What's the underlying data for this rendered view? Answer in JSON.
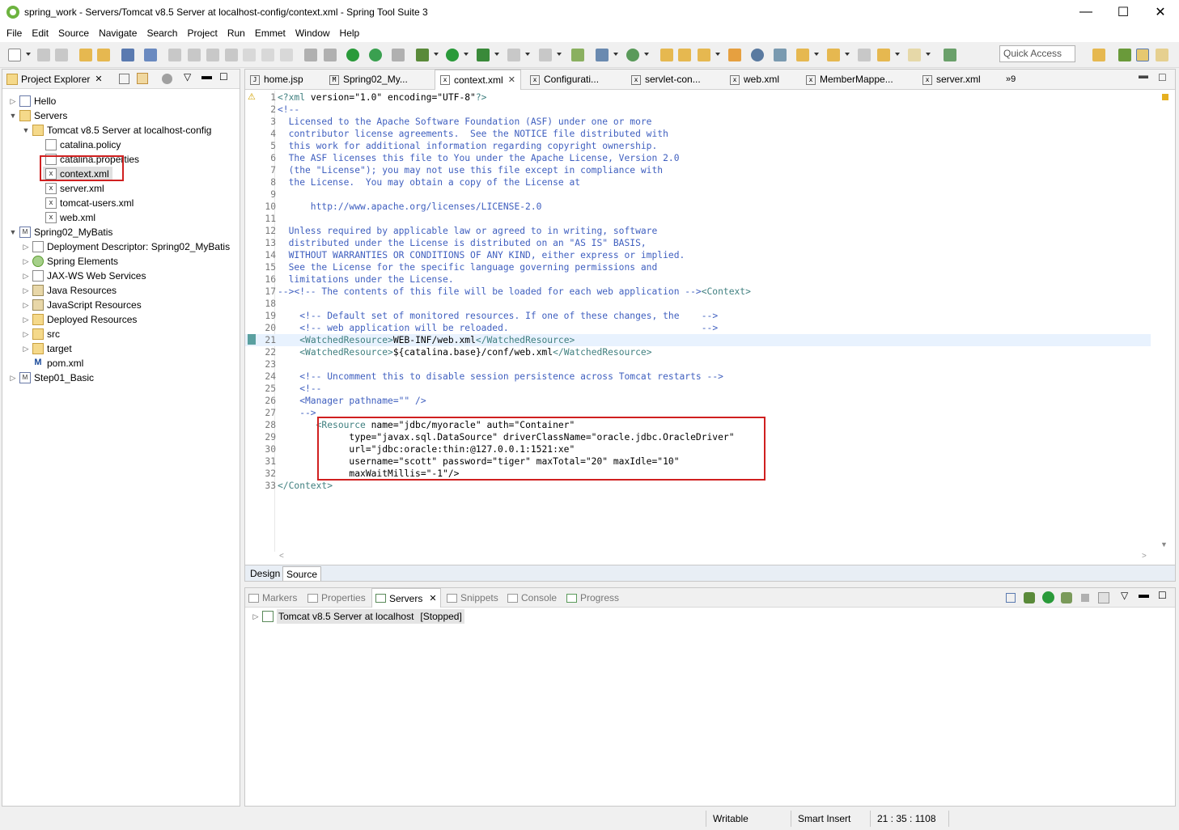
{
  "window": {
    "title": "spring_work - Servers/Tomcat v8.5 Server at localhost-config/context.xml - Spring Tool Suite 3",
    "minimize": "—",
    "maximize": "☐",
    "close": "✕"
  },
  "menu": [
    "File",
    "Edit",
    "Source",
    "Navigate",
    "Search",
    "Project",
    "Run",
    "Emmet",
    "Window",
    "Help"
  ],
  "quick_access": {
    "placeholder": "Quick Access"
  },
  "project_explorer": {
    "title": "Project Explorer",
    "items": [
      {
        "label": "Hello",
        "icon": "project-icon"
      },
      {
        "label": "Servers",
        "icon": "folder-icon"
      },
      {
        "label": "Tomcat v8.5 Server at localhost-config",
        "icon": "folder-icon"
      },
      {
        "label": "catalina.policy",
        "icon": "file-icon"
      },
      {
        "label": "catalina.properties",
        "icon": "file-icon"
      },
      {
        "label": "context.xml",
        "icon": "xml-file-icon"
      },
      {
        "label": "server.xml",
        "icon": "xml-file-icon"
      },
      {
        "label": "tomcat-users.xml",
        "icon": "xml-file-icon"
      },
      {
        "label": "web.xml",
        "icon": "xml-file-icon"
      },
      {
        "label": "Spring02_MyBatis",
        "icon": "maven-project-icon"
      },
      {
        "label": "Deployment Descriptor: Spring02_MyBatis",
        "icon": "descriptor-icon"
      },
      {
        "label": "Spring Elements",
        "icon": "spring-icon"
      },
      {
        "label": "JAX-WS Web Services",
        "icon": "webservice-icon"
      },
      {
        "label": "Java Resources",
        "icon": "java-resources-icon"
      },
      {
        "label": "JavaScript Resources",
        "icon": "javascript-resources-icon"
      },
      {
        "label": "Deployed Resources",
        "icon": "folder-icon"
      },
      {
        "label": "src",
        "icon": "folder-icon"
      },
      {
        "label": "target",
        "icon": "folder-icon"
      },
      {
        "label": "pom.xml",
        "icon": "maven-file-icon"
      },
      {
        "label": "Step01_Basic",
        "icon": "maven-project-icon"
      }
    ]
  },
  "editor_tabs": [
    {
      "label": "home.jsp"
    },
    {
      "label": "Spring02_My..."
    },
    {
      "label": "context.xml"
    },
    {
      "label": "Configurati..."
    },
    {
      "label": "servlet-con..."
    },
    {
      "label": "web.xml"
    },
    {
      "label": "MemberMappe..."
    },
    {
      "label": "server.xml"
    },
    {
      "label": "»9"
    }
  ],
  "code_lines": [
    {
      "n": "1",
      "text": "<?xml version=\"1.0\" encoding=\"UTF-8\"?>"
    },
    {
      "n": "2",
      "text": "<!--"
    },
    {
      "n": "3",
      "text": "  Licensed to the Apache Software Foundation (ASF) under one or more"
    },
    {
      "n": "4",
      "text": "  contributor license agreements.  See the NOTICE file distributed with"
    },
    {
      "n": "5",
      "text": "  this work for additional information regarding copyright ownership."
    },
    {
      "n": "6",
      "text": "  The ASF licenses this file to You under the Apache License, Version 2.0"
    },
    {
      "n": "7",
      "text": "  (the \"License\"); you may not use this file except in compliance with"
    },
    {
      "n": "8",
      "text": "  the License.  You may obtain a copy of the License at"
    },
    {
      "n": "9",
      "text": ""
    },
    {
      "n": "10",
      "text": "      http://www.apache.org/licenses/LICENSE-2.0"
    },
    {
      "n": "11",
      "text": ""
    },
    {
      "n": "12",
      "text": "  Unless required by applicable law or agreed to in writing, software"
    },
    {
      "n": "13",
      "text": "  distributed under the License is distributed on an \"AS IS\" BASIS,"
    },
    {
      "n": "14",
      "text": "  WITHOUT WARRANTIES OR CONDITIONS OF ANY KIND, either express or implied."
    },
    {
      "n": "15",
      "text": "  See the License for the specific language governing permissions and"
    },
    {
      "n": "16",
      "text": "  limitations under the License."
    },
    {
      "n": "17",
      "text": "--><!-- The contents of this file will be loaded for each web application --><Context>"
    },
    {
      "n": "18",
      "text": ""
    },
    {
      "n": "19",
      "text": "    <!-- Default set of monitored resources. If one of these changes, the    -->"
    },
    {
      "n": "20",
      "text": "    <!-- web application will be reloaded.                                   -->"
    },
    {
      "n": "21",
      "text": "    <WatchedResource>WEB-INF/web.xml</WatchedResource>"
    },
    {
      "n": "22",
      "text": "    <WatchedResource>${catalina.base}/conf/web.xml</WatchedResource>"
    },
    {
      "n": "23",
      "text": ""
    },
    {
      "n": "24",
      "text": "    <!-- Uncomment this to disable session persistence across Tomcat restarts -->"
    },
    {
      "n": "25",
      "text": "    <!--"
    },
    {
      "n": "26",
      "text": "    <Manager pathname=\"\" />"
    },
    {
      "n": "27",
      "text": "    -->"
    },
    {
      "n": "28",
      "text": "       <Resource name=\"jdbc/myoracle\" auth=\"Container\""
    },
    {
      "n": "29",
      "text": "             type=\"javax.sql.DataSource\" driverClassName=\"oracle.jdbc.OracleDriver\""
    },
    {
      "n": "30",
      "text": "             url=\"jdbc:oracle:thin:@127.0.0.1:1521:xe\""
    },
    {
      "n": "31",
      "text": "             username=\"scott\" password=\"tiger\" maxTotal=\"20\" maxIdle=\"10\""
    },
    {
      "n": "32",
      "text": "             maxWaitMillis=\"-1\"/>"
    },
    {
      "n": "33",
      "text": "</Context>"
    }
  ],
  "editor_bottom_tabs": {
    "design": "Design",
    "source": "Source"
  },
  "bottom_tabs": [
    {
      "label": "Markers"
    },
    {
      "label": "Properties"
    },
    {
      "label": "Servers"
    },
    {
      "label": "Snippets"
    },
    {
      "label": "Console"
    },
    {
      "label": "Progress"
    }
  ],
  "servers_view": {
    "server_name": "Tomcat v8.5 Server at localhost",
    "server_state": "[Stopped]"
  },
  "status": {
    "writable": "Writable",
    "insert_mode": "Smart Insert",
    "position": "21 : 35 : 1108"
  },
  "colors": {
    "selection_highlight": "#d02020",
    "xml_tag": "#3f7f7f",
    "xml_attribute": "#7f007f",
    "xml_value": "#2a00ff",
    "xml_comment": "#3f5fbf"
  }
}
